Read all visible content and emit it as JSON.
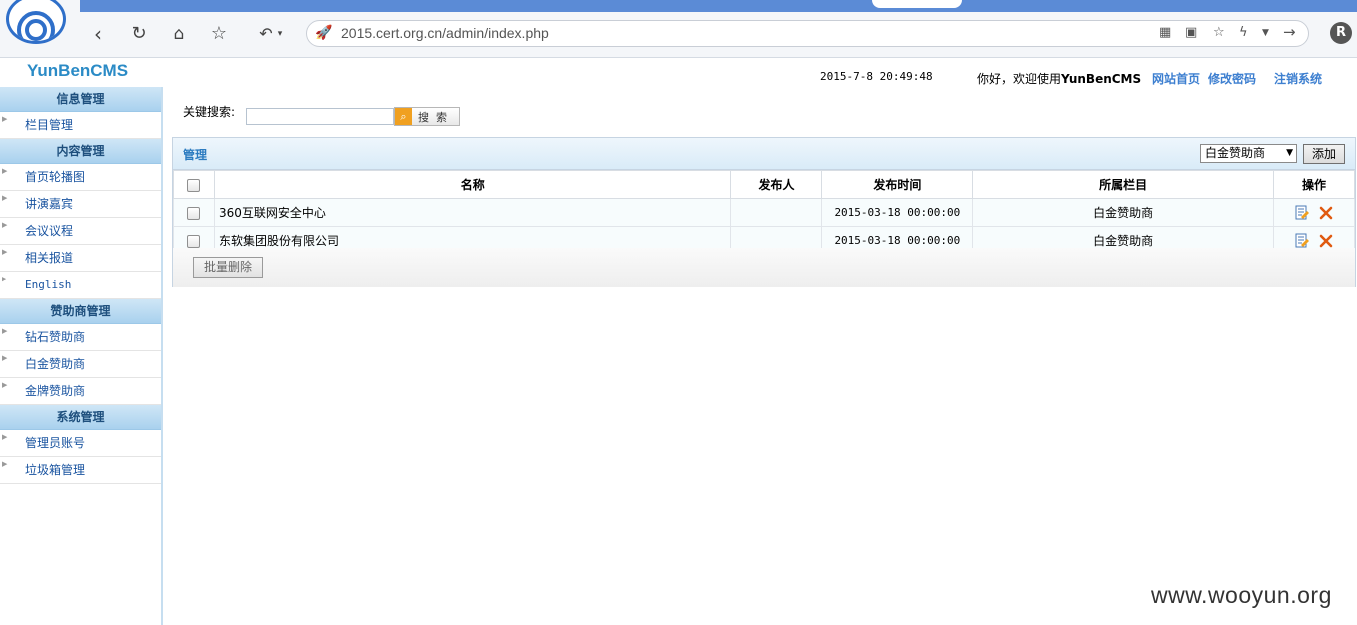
{
  "browser": {
    "url": "2015.cert.org.cn/admin/index.php"
  },
  "brand": "YunBenCMS",
  "header": {
    "datetime": "2015-7-8  20:49:48",
    "welcome_prefix": "你好，欢迎使用",
    "welcome_brand": "YunBenCMS",
    "links": [
      "网站首页",
      "修改密码",
      "注销系统"
    ]
  },
  "sidebar": {
    "groups": [
      {
        "title": "信息管理",
        "items": [
          "栏目管理"
        ]
      },
      {
        "title": "内容管理",
        "items": [
          "首页轮播图",
          "讲演嘉宾",
          "会议议程",
          "相关报道",
          "English"
        ]
      },
      {
        "title": "赞助商管理",
        "items": [
          "钻石赞助商",
          "白金赞助商",
          "金牌赞助商"
        ]
      },
      {
        "title": "系统管理",
        "items": [
          "管理员账号",
          "垃圾箱管理"
        ]
      }
    ]
  },
  "search": {
    "label": "关键搜索:",
    "button_label": "搜索"
  },
  "panel": {
    "title": "管理",
    "select_value": "白金赞助商",
    "add_label": "添加",
    "batch_delete_label": "批量删除",
    "columns": [
      "名称",
      "发布人",
      "发布时间",
      "所属栏目",
      "操作"
    ],
    "rows": [
      {
        "name": "360互联网安全中心",
        "publisher": "",
        "time": "2015-03-18 00:00:00",
        "category": "白金赞助商"
      },
      {
        "name": "东软集团股份有限公司",
        "publisher": "",
        "time": "2015-03-18 00:00:00",
        "category": "白金赞助商"
      }
    ]
  },
  "watermark": "www.wooyun.org"
}
